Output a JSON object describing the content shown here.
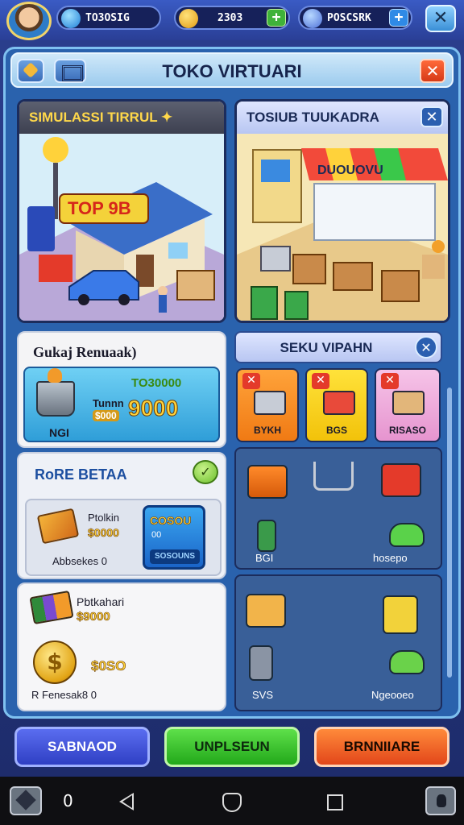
{
  "hud": {
    "currency1": "TO3OSIG",
    "currency2": "2303",
    "currency3": "POSCSRK",
    "plus": "+",
    "close": "✕"
  },
  "panel": {
    "title": "TOKO VIRTUARI",
    "close": "✕"
  },
  "scene_left": {
    "title": "SIMULASSI TIRRUL ✦",
    "sign": "TOP 9B"
  },
  "scene_right": {
    "title": "TOSIUB TUUKADRA",
    "close": "✕",
    "awning": "DUOUOVU"
  },
  "gudang": {
    "title": "Gukaj Renuaak)",
    "top_value": "TO30000",
    "item_name": "Tunnn",
    "item_price": "$000",
    "big_value": "9000",
    "foot": "NGI"
  },
  "rare": {
    "title": "RoRE BETAA",
    "check": "✓",
    "item_name": "Ptolkin",
    "item_price": "$0000",
    "stock": "Abbsekes 0",
    "btn_top": "COSOU",
    "btn_mid": "00",
    "btn_foot": "SOSOUNS"
  },
  "money": {
    "item_name": "Pbtkahari",
    "item_price": "$9000",
    "coin": "$",
    "price2": "$0SO",
    "stock": "R Fenesak8 0"
  },
  "sekvu": {
    "title": "SEKU VIPAHN",
    "close": "✕",
    "categories": [
      {
        "label": "BYKH"
      },
      {
        "label": "BGS"
      },
      {
        "label": "RISASO"
      }
    ],
    "cat_x": "✕"
  },
  "shelf1": {
    "label_left": "BGI",
    "label_right": "hosepo"
  },
  "shelf2": {
    "label_left": "SVS",
    "label_right": "Ngeooeo"
  },
  "buttons": {
    "b1": "SABNAOD",
    "b2": "UNPLSEUN",
    "b3": "BRNNIIARE"
  },
  "nav": {
    "zero": "0"
  }
}
